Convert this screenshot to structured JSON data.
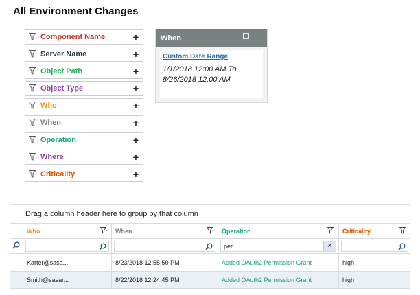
{
  "page": {
    "title": "All Environment Changes"
  },
  "colors": {
    "component_name": "#c0392b",
    "server_name": "#2c3e50",
    "object_path": "#27ae60",
    "object_type": "#8e44ad",
    "who": "#e69520",
    "when": "#7b8183",
    "operation": "#1aa37a",
    "where": "#8e44ad",
    "criticality": "#d35400",
    "link": "#2b6aa7"
  },
  "filters": [
    {
      "label": "Component Name",
      "color": "#c0392b",
      "icon": "filter-icon",
      "action": "+"
    },
    {
      "label": "Server Name",
      "color": "#2c3e50",
      "icon": "filter-icon",
      "action": "+"
    },
    {
      "label": "Object Path",
      "color": "#27ae60",
      "icon": "filter-icon",
      "action": "+"
    },
    {
      "label": "Object Type",
      "color": "#8e44ad",
      "icon": "filter-icon",
      "action": "+"
    },
    {
      "label": "Who",
      "color": "#e69520",
      "icon": "filter-icon",
      "action": "+"
    },
    {
      "label": "When",
      "color": "#7b8183",
      "icon": "filter-icon",
      "action": "+"
    },
    {
      "label": "Operation",
      "color": "#1aa37a",
      "icon": "filter-icon",
      "action": "+"
    },
    {
      "label": "Where",
      "color": "#8e44ad",
      "icon": "filter-icon",
      "action": "+"
    },
    {
      "label": "Criticality",
      "color": "#d35400",
      "icon": "filter-icon",
      "action": "+"
    }
  ],
  "when_panel": {
    "title": "When",
    "collapse_icon": "collapse-icon",
    "link": "Custom Date Range",
    "range_line1": "1/1/2018 12:00 AM To",
    "range_line2": "8/26/2018 12:00 AM"
  },
  "grid": {
    "group_hint": "Drag a column header here to group by that column",
    "columns": [
      {
        "label": "Who",
        "color": "#e69520"
      },
      {
        "label": "When",
        "color": "#7b8183"
      },
      {
        "label": "Operation",
        "color": "#1aa37a"
      },
      {
        "label": "Criticality",
        "color": "#d35400"
      }
    ],
    "search": {
      "who": "",
      "when": "",
      "operation": "per",
      "criticality": "",
      "clear_label": "×"
    },
    "rows": [
      {
        "who": "Karter@sasa...",
        "when": "8/23/2018 12:55:50 PM",
        "operation": "Added OAuth2 Permission Grant",
        "criticality": "high"
      },
      {
        "who": "Smith@sasar...",
        "when": "8/22/2018 12:24:45 PM",
        "operation": "Added OAuth2 Permission Grant",
        "criticality": "high"
      }
    ]
  }
}
